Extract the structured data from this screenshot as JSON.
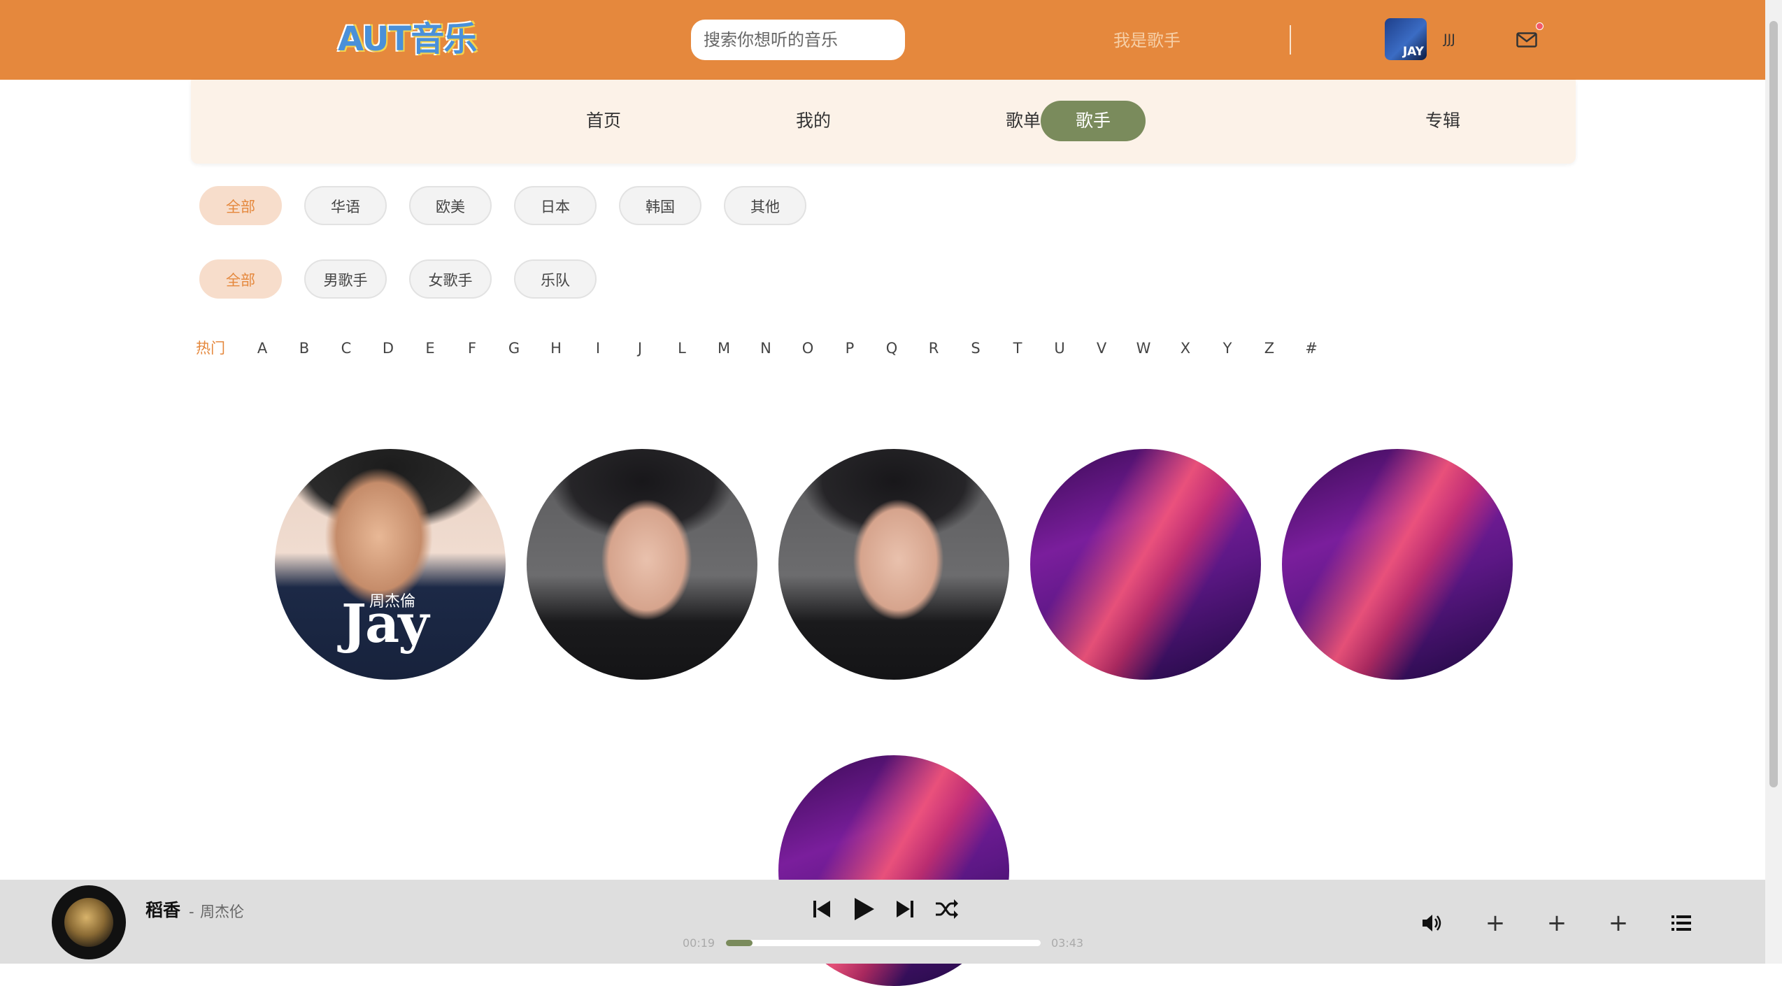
{
  "header": {
    "logo": "AUT音乐",
    "search_placeholder": "搜索你想听的音乐",
    "iam_singer": "我是歌手",
    "user_name": "JJJ",
    "avatar_text": "JAY"
  },
  "nav": {
    "items": [
      "首页",
      "我的",
      "歌单",
      "歌手",
      "专辑"
    ],
    "active": "歌手"
  },
  "filters": {
    "region": [
      "全部",
      "华语",
      "欧美",
      "日本",
      "韩国",
      "其他"
    ],
    "type": [
      "全部",
      "男歌手",
      "女歌手",
      "乐队"
    ],
    "active_region": "全部",
    "active_type": "全部",
    "letters": [
      "热门",
      "A",
      "B",
      "C",
      "D",
      "E",
      "F",
      "G",
      "H",
      "I",
      "J",
      "L",
      "M",
      "N",
      "O",
      "P",
      "Q",
      "R",
      "S",
      "T",
      "U",
      "V",
      "W",
      "X",
      "Y",
      "Z",
      "#"
    ],
    "active_letter": "热门"
  },
  "singers": {
    "jay_text": "Jay",
    "jay_cn": "周杰倫"
  },
  "player": {
    "title": "稻香",
    "separator": "-",
    "artist": "周杰伦",
    "current_time": "00:19",
    "total_time": "03:43",
    "progress": 0.085
  },
  "colors": {
    "header": "#e5883d",
    "accent_green": "#7a8b5c",
    "nav_bg": "#fcf2e8"
  }
}
